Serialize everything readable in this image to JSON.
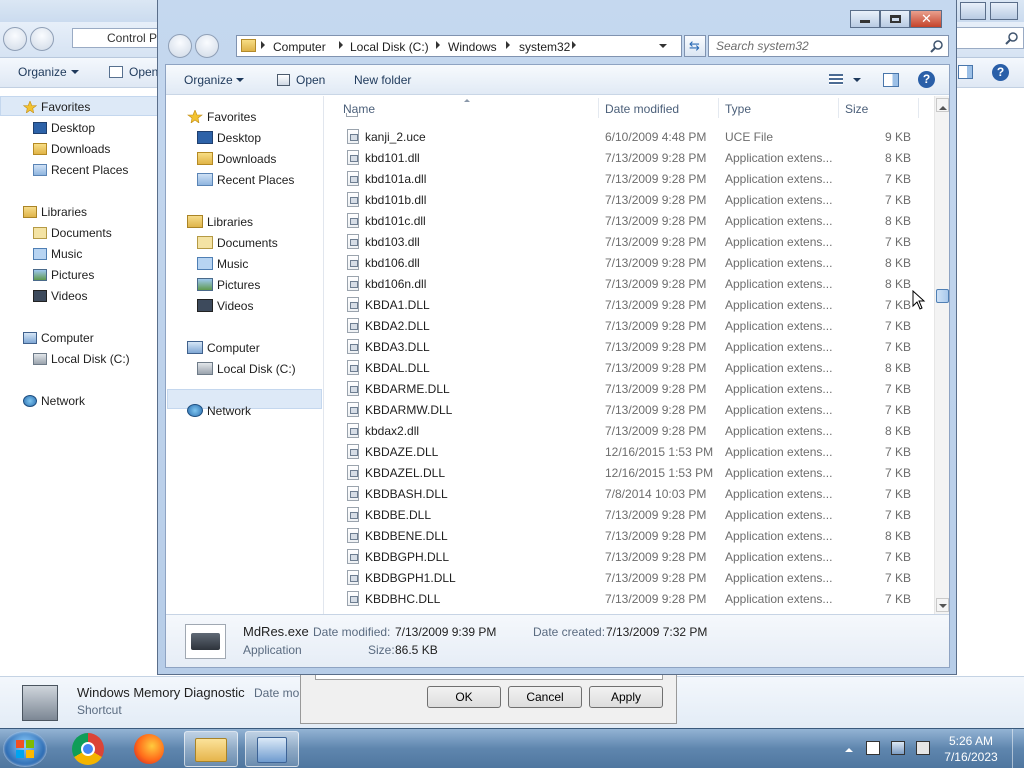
{
  "background_window": {
    "breadcrumb_text": "Control P",
    "toolbar": {
      "organize": "Organize",
      "open": "Open"
    },
    "nav": {
      "favorites": "Favorites",
      "desktop": "Desktop",
      "downloads": "Downloads",
      "recent_places": "Recent Places",
      "libraries": "Libraries",
      "documents": "Documents",
      "music": "Music",
      "pictures": "Pictures",
      "videos": "Videos",
      "computer": "Computer",
      "local_disk": "Local Disk (C:)",
      "network": "Network"
    },
    "details": {
      "name": "Windows Memory Diagnostic",
      "date_label": "Date mo",
      "type": "Shortcut"
    }
  },
  "properties_dialog": {
    "ok": "OK",
    "cancel": "Cancel",
    "apply": "Apply"
  },
  "open_dialog": {
    "breadcrumb": [
      "Computer",
      "Local Disk (C:)",
      "Windows",
      "system32"
    ],
    "search_placeholder": "Search system32",
    "toolbar": {
      "organize": "Organize",
      "open": "Open",
      "new_folder": "New folder"
    },
    "nav": {
      "favorites": "Favorites",
      "desktop": "Desktop",
      "downloads": "Downloads",
      "recent_places": "Recent Places",
      "libraries": "Libraries",
      "documents": "Documents",
      "music": "Music",
      "pictures": "Pictures",
      "videos": "Videos",
      "computer": "Computer",
      "local_disk": "Local Disk (C:)",
      "network": "Network"
    },
    "columns": {
      "name": "Name",
      "date_modified": "Date modified",
      "type": "Type",
      "size": "Size"
    },
    "files": [
      {
        "name": "kanji_2.uce",
        "date": "6/10/2009 4:48 PM",
        "type": "UCE File",
        "size": "9 KB"
      },
      {
        "name": "kbd101.dll",
        "date": "7/13/2009 9:28 PM",
        "type": "Application extens...",
        "size": "8 KB"
      },
      {
        "name": "kbd101a.dll",
        "date": "7/13/2009 9:28 PM",
        "type": "Application extens...",
        "size": "7 KB"
      },
      {
        "name": "kbd101b.dll",
        "date": "7/13/2009 9:28 PM",
        "type": "Application extens...",
        "size": "7 KB"
      },
      {
        "name": "kbd101c.dll",
        "date": "7/13/2009 9:28 PM",
        "type": "Application extens...",
        "size": "8 KB"
      },
      {
        "name": "kbd103.dll",
        "date": "7/13/2009 9:28 PM",
        "type": "Application extens...",
        "size": "7 KB"
      },
      {
        "name": "kbd106.dll",
        "date": "7/13/2009 9:28 PM",
        "type": "Application extens...",
        "size": "8 KB"
      },
      {
        "name": "kbd106n.dll",
        "date": "7/13/2009 9:28 PM",
        "type": "Application extens...",
        "size": "8 KB"
      },
      {
        "name": "KBDA1.DLL",
        "date": "7/13/2009 9:28 PM",
        "type": "Application extens...",
        "size": "7 KB"
      },
      {
        "name": "KBDA2.DLL",
        "date": "7/13/2009 9:28 PM",
        "type": "Application extens...",
        "size": "7 KB"
      },
      {
        "name": "KBDA3.DLL",
        "date": "7/13/2009 9:28 PM",
        "type": "Application extens...",
        "size": "7 KB"
      },
      {
        "name": "KBDAL.DLL",
        "date": "7/13/2009 9:28 PM",
        "type": "Application extens...",
        "size": "8 KB"
      },
      {
        "name": "KBDARME.DLL",
        "date": "7/13/2009 9:28 PM",
        "type": "Application extens...",
        "size": "7 KB"
      },
      {
        "name": "KBDARMW.DLL",
        "date": "7/13/2009 9:28 PM",
        "type": "Application extens...",
        "size": "7 KB"
      },
      {
        "name": "kbdax2.dll",
        "date": "7/13/2009 9:28 PM",
        "type": "Application extens...",
        "size": "8 KB"
      },
      {
        "name": "KBDAZE.DLL",
        "date": "12/16/2015 1:53 PM",
        "type": "Application extens...",
        "size": "7 KB"
      },
      {
        "name": "KBDAZEL.DLL",
        "date": "12/16/2015 1:53 PM",
        "type": "Application extens...",
        "size": "7 KB"
      },
      {
        "name": "KBDBASH.DLL",
        "date": "7/8/2014 10:03 PM",
        "type": "Application extens...",
        "size": "7 KB"
      },
      {
        "name": "KBDBE.DLL",
        "date": "7/13/2009 9:28 PM",
        "type": "Application extens...",
        "size": "7 KB"
      },
      {
        "name": "KBDBENE.DLL",
        "date": "7/13/2009 9:28 PM",
        "type": "Application extens...",
        "size": "8 KB"
      },
      {
        "name": "KBDBGPH.DLL",
        "date": "7/13/2009 9:28 PM",
        "type": "Application extens...",
        "size": "7 KB"
      },
      {
        "name": "KBDBGPH1.DLL",
        "date": "7/13/2009 9:28 PM",
        "type": "Application extens...",
        "size": "7 KB"
      },
      {
        "name": "KBDBHC.DLL",
        "date": "7/13/2009 9:28 PM",
        "type": "Application extens...",
        "size": "7 KB"
      }
    ],
    "details": {
      "name": "MdRes.exe",
      "date_modified_label": "Date modified:",
      "date_modified": "7/13/2009 9:39 PM",
      "date_created_label": "Date created:",
      "date_created": "7/13/2009 7:32 PM",
      "type": "Application",
      "size_label": "Size:",
      "size": "86.5 KB"
    }
  },
  "taskbar": {
    "time": "5:26 AM",
    "date": "7/16/2023"
  },
  "icons": [
    "folder-icon",
    "star-icon",
    "desktop-icon",
    "downloads-icon",
    "recent-places-icon",
    "library-icon",
    "documents-icon",
    "music-icon",
    "pictures-icon",
    "videos-icon",
    "computer-icon",
    "drive-icon",
    "network-icon",
    "dll-file-icon",
    "executable-chip-icon",
    "chrome-icon",
    "firefox-icon",
    "explorer-icon",
    "control-panel-icon",
    "help-icon",
    "views-icon",
    "preview-pane-icon",
    "refresh-icon"
  ],
  "colors": {
    "selection": "#dde9f7",
    "title_gradient": "#c5d8ef",
    "taskbar": "#5f86ae",
    "link_blue": "#1e395b"
  }
}
